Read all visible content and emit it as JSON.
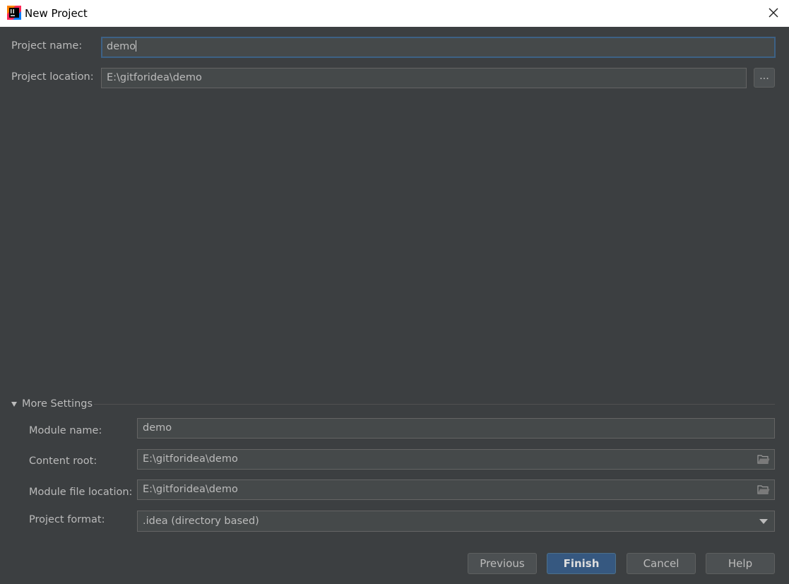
{
  "window": {
    "title": "New Project"
  },
  "form": {
    "project_name_label": "Project name:",
    "project_name_value": "demo",
    "project_location_label": "Project location:",
    "project_location_value": "E:\\gitforidea\\demo",
    "browse_label": "..."
  },
  "more_settings": {
    "header": "More Settings",
    "module_name_label": "Module name:",
    "module_name_value": "demo",
    "content_root_label": "Content root:",
    "content_root_value": "E:\\gitforidea\\demo",
    "module_file_location_label": "Module file location:",
    "module_file_location_value": "E:\\gitforidea\\demo",
    "project_format_label": "Project format:",
    "project_format_value": ".idea (directory based)"
  },
  "buttons": {
    "previous": "Previous",
    "finish": "Finish",
    "cancel": "Cancel",
    "help": "Help"
  },
  "colors": {
    "background": "#3c3f41",
    "field_bg": "#45494a",
    "focus_border": "#3d6185",
    "primary_button": "#365880",
    "text": "#bbbbbb"
  },
  "icons": [
    "intellij-app-icon",
    "close-icon",
    "folder-icon",
    "chevron-down-icon",
    "triangle-down-icon"
  ]
}
